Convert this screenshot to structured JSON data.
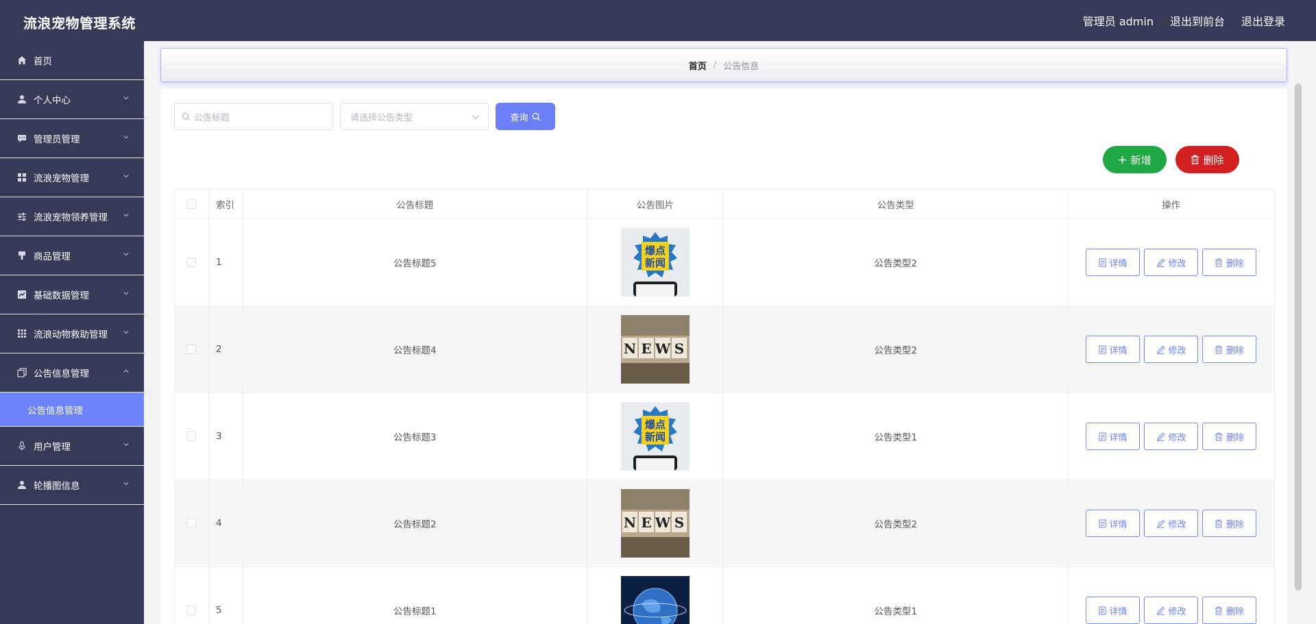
{
  "header": {
    "app_title": "流浪宠物管理系统",
    "admin_label": "管理员 admin",
    "to_front_label": "退出到前台",
    "logout_label": "退出登录"
  },
  "sidebar": {
    "items": [
      {
        "label": "首页",
        "icon": "home-icon"
      },
      {
        "label": "个人中心",
        "icon": "user-icon"
      },
      {
        "label": "管理员管理",
        "icon": "chat-icon"
      },
      {
        "label": "流浪宠物管理",
        "icon": "grid-icon"
      },
      {
        "label": "流浪宠物领养管理",
        "icon": "sliders-icon"
      },
      {
        "label": "商品管理",
        "icon": "brush-icon"
      },
      {
        "label": "基础数据管理",
        "icon": "chart-icon"
      },
      {
        "label": "流浪动物救助管理",
        "icon": "apps-icon"
      },
      {
        "label": "公告信息管理",
        "icon": "copy-icon"
      },
      {
        "label": "用户管理",
        "icon": "mic-icon"
      },
      {
        "label": "轮播图信息",
        "icon": "user-icon"
      }
    ],
    "sub_item": "公告信息管理"
  },
  "breadcrumb": {
    "home": "首页",
    "separator": "/",
    "current": "公告信息"
  },
  "search": {
    "title_placeholder": "公告标题",
    "type_placeholder": "请选择公告类型",
    "query_label": "查询"
  },
  "actions": {
    "add_label": "新增",
    "delete_label": "删除"
  },
  "table": {
    "headers": {
      "index": "索引",
      "title": "公告标题",
      "image": "公告图片",
      "type": "公告类型",
      "ops": "操作"
    },
    "rows": [
      {
        "index": "1",
        "title": "公告标题5",
        "image": "burst-news",
        "type": "公告类型2"
      },
      {
        "index": "2",
        "title": "公告标题4",
        "image": "news-cubes",
        "type": "公告类型2"
      },
      {
        "index": "3",
        "title": "公告标题3",
        "image": "burst-news",
        "type": "公告类型1"
      },
      {
        "index": "4",
        "title": "公告标题2",
        "image": "news-cubes",
        "type": "公告类型2"
      },
      {
        "index": "5",
        "title": "公告标题1",
        "image": "globe-news",
        "type": "公告类型1"
      }
    ],
    "op_labels": {
      "detail": "详情",
      "edit": "修改",
      "delete": "删除"
    }
  },
  "thumb_text": {
    "burst_line1": "爆点",
    "burst_line2": "新闻",
    "cubes": [
      "N",
      "E",
      "W",
      "S"
    ]
  },
  "colors": {
    "header_bg": "#363a57",
    "accent": "#6b7ff8",
    "add": "#20a845",
    "delete": "#d21f1f"
  }
}
